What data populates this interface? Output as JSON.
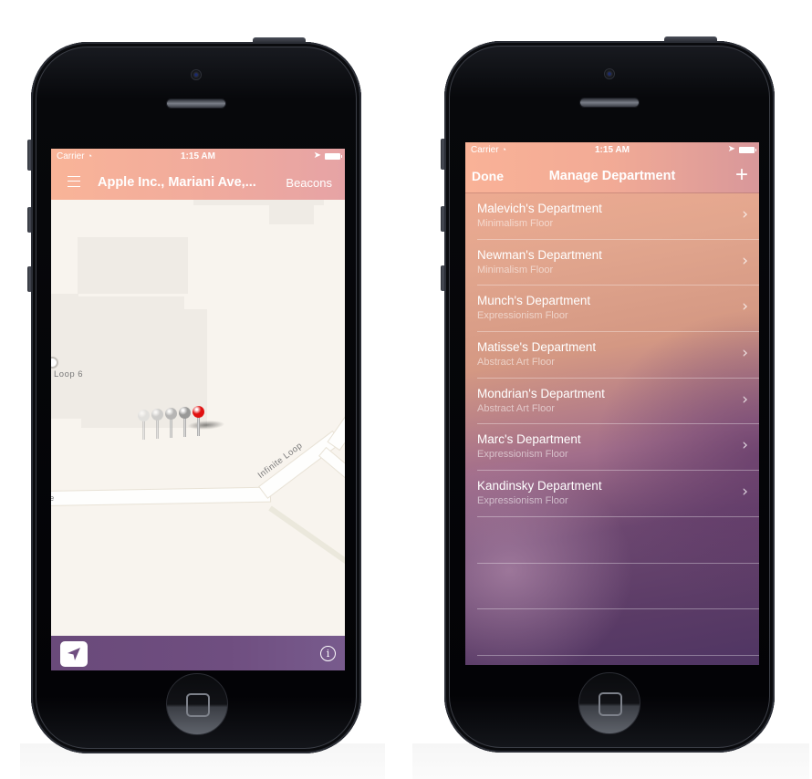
{
  "left_phone": {
    "status_bar": {
      "carrier": "Carrier",
      "time": "1:15 AM"
    },
    "navbar": {
      "menu_icon": "hamburger-icon",
      "title": "Apple Inc., Mariani Ave,...",
      "right_button": "Beacons"
    },
    "map": {
      "labels": {
        "poi": "Loop 6",
        "road_1": "Infinite Loop",
        "road_2": "e"
      },
      "pins": [
        {
          "color": "#e01010",
          "active": true
        },
        {
          "color": "#8e8e8e",
          "active": false
        },
        {
          "color": "#a5a5a5",
          "active": false
        },
        {
          "color": "#bdbdbd",
          "active": false
        },
        {
          "color": "#d6d6d6",
          "active": false
        }
      ]
    },
    "toolbar": {
      "locate_icon": "location-arrow-icon",
      "info_icon": "info-icon",
      "info_glyph": "i"
    }
  },
  "right_phone": {
    "status_bar": {
      "carrier": "Carrier",
      "time": "1:15 AM"
    },
    "navbar": {
      "left_button": "Done",
      "title": "Manage Department",
      "right_button": "+"
    },
    "departments": [
      {
        "name": "Malevich's Department",
        "floor": "Minimalism Floor"
      },
      {
        "name": "Newman's Department",
        "floor": "Minimalism Floor"
      },
      {
        "name": "Munch's Department",
        "floor": "Expressionism Floor"
      },
      {
        "name": "Matisse's Department",
        "floor": "Abstract Art Floor"
      },
      {
        "name": "Mondrian's Department",
        "floor": "Abstract Art Floor"
      },
      {
        "name": "Marc's Department",
        "floor": "Expressionism Floor"
      },
      {
        "name": "Kandinsky Department",
        "floor": "Expressionism Floor"
      }
    ],
    "chevron": "›"
  },
  "colors": {
    "header_peach": "#f9b498",
    "toolbar_purple": "#6f4e80",
    "map_bg": "#f8f4ee",
    "pin_red": "#e01010"
  }
}
